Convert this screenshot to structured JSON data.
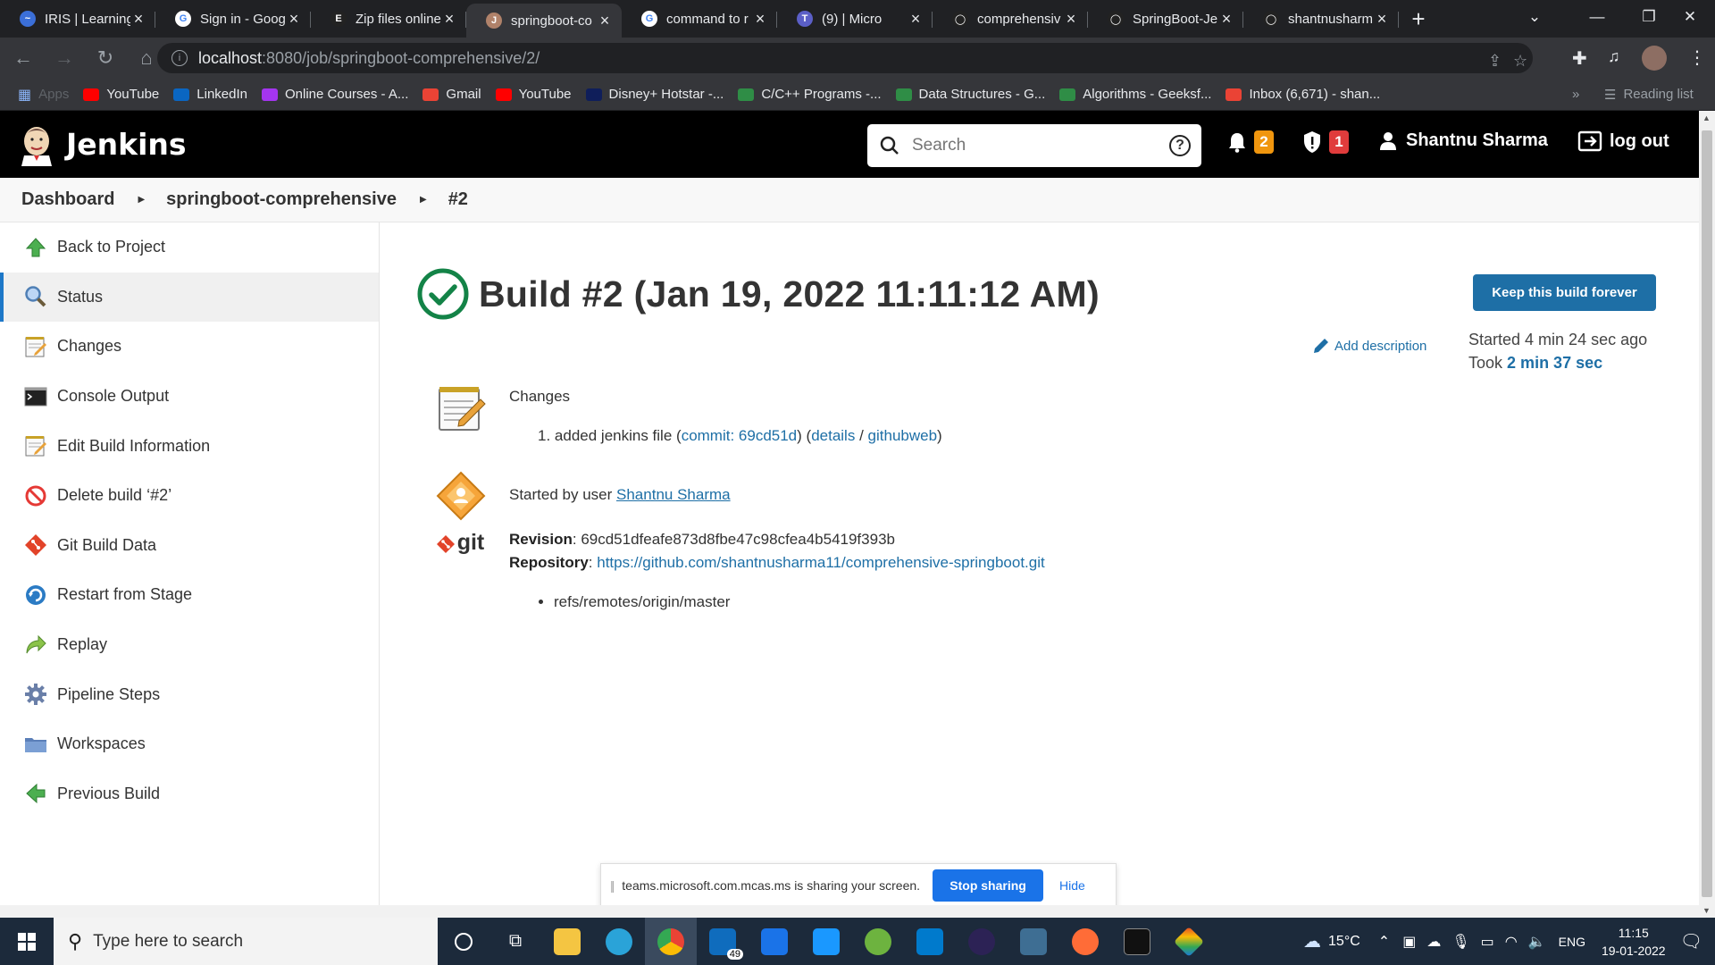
{
  "browser": {
    "tabs": [
      {
        "label": "IRIS | Learning",
        "color": "#3b6fd8",
        "glyph": "~"
      },
      {
        "label": "Sign in - Goog",
        "color": "#ffffff",
        "glyph": "G"
      },
      {
        "label": "Zip files online",
        "color": "#222222",
        "glyph": "E"
      },
      {
        "label": "springboot-co",
        "color": "#b0826a",
        "glyph": "J",
        "active": true
      },
      {
        "label": "command to r",
        "color": "#ffffff",
        "glyph": "G"
      },
      {
        "label": "(9) | Micro",
        "color": "#5b5fc7",
        "glyph": "T"
      },
      {
        "label": "comprehensiv",
        "color": "#222222",
        "glyph": "◯"
      },
      {
        "label": "SpringBoot-Je",
        "color": "#222222",
        "glyph": "◯"
      },
      {
        "label": "shantnusharm",
        "color": "#222222",
        "glyph": "◯"
      }
    ],
    "url_host": "localhost",
    "url_path": ":8080/job/springboot-comprehensive/2/",
    "bookmarks": [
      {
        "label": "Apps",
        "color": "#8ab4f8"
      },
      {
        "label": "YouTube",
        "color": "#ff0000"
      },
      {
        "label": "LinkedIn",
        "color": "#0a66c2"
      },
      {
        "label": "Online Courses - A...",
        "color": "#a435f0"
      },
      {
        "label": "Gmail",
        "color": "#ea4335"
      },
      {
        "label": "YouTube",
        "color": "#ff0000"
      },
      {
        "label": "Disney+ Hotstar -...",
        "color": "#0f1e5a"
      },
      {
        "label": "C/C++ Programs -...",
        "color": "#2f8d46"
      },
      {
        "label": "Data Structures - G...",
        "color": "#2f8d46"
      },
      {
        "label": "Algorithms - Geeksf...",
        "color": "#2f8d46"
      },
      {
        "label": "Inbox (6,671) - shan...",
        "color": "#ea4335"
      }
    ],
    "reading_list": "Reading list"
  },
  "header": {
    "logo_text": "Jenkins",
    "search_placeholder": "Search",
    "notifications_count": "2",
    "security_count": "1",
    "user_name": "Shantnu Sharma",
    "logout_label": "log out",
    "colors": {
      "notif": "#f0960e",
      "security": "#e03c3c"
    }
  },
  "breadcrumb": {
    "items": [
      "Dashboard",
      "springboot-comprehensive",
      "#2"
    ]
  },
  "sidebar": {
    "items": [
      {
        "label": "Back to Project",
        "icon": "up-arrow-icon"
      },
      {
        "label": "Status",
        "icon": "magnifier-icon",
        "active": true
      },
      {
        "label": "Changes",
        "icon": "notepad-icon"
      },
      {
        "label": "Console Output",
        "icon": "terminal-icon"
      },
      {
        "label": "Edit Build Information",
        "icon": "notepad-icon"
      },
      {
        "label": "Delete build ‘#2’",
        "icon": "no-entry-icon"
      },
      {
        "label": "Git Build Data",
        "icon": "git-icon"
      },
      {
        "label": "Restart from Stage",
        "icon": "restart-icon"
      },
      {
        "label": "Replay",
        "icon": "replay-arrow-icon"
      },
      {
        "label": "Pipeline Steps",
        "icon": "gear-icon"
      },
      {
        "label": "Workspaces",
        "icon": "folder-icon"
      },
      {
        "label": "Previous Build",
        "icon": "left-arrow-icon"
      }
    ]
  },
  "main": {
    "title": "Build #2 (Jan 19, 2022 11:11:12 AM)",
    "keep_button": "Keep this build forever",
    "add_description": "Add description",
    "started_text": "Started 4 min 24 sec ago",
    "took_label": "Took",
    "took_value": "2 min 37 sec",
    "changes": {
      "heading": "Changes",
      "item_number": "1.",
      "item_text": "added jenkins file",
      "commit_label": "commit: 69cd51d",
      "details_label": "details",
      "separator": "/",
      "githubweb_label": "githubweb"
    },
    "started_by": {
      "prefix": "Started by user",
      "user": "Shantnu Sharma"
    },
    "git": {
      "logo_text": "git",
      "revision_label": "Revision",
      "revision_value": "69cd51dfeafe873d8fbe47c98cfea4b5419f393b",
      "repository_label": "Repository",
      "repository_value": "https://github.com/shantnusharma11/comprehensive-springboot.git",
      "branch": "refs/remotes/origin/master"
    }
  },
  "share_bar": {
    "message": "teams.microsoft.com.mcas.ms is sharing your screen.",
    "stop_label": "Stop sharing",
    "hide_label": "Hide"
  },
  "taskbar": {
    "search_placeholder": "Type here to search",
    "mail_badge": "49",
    "weather": "15°C",
    "language": "ENG",
    "time": "11:15",
    "date": "19-01-2022"
  }
}
